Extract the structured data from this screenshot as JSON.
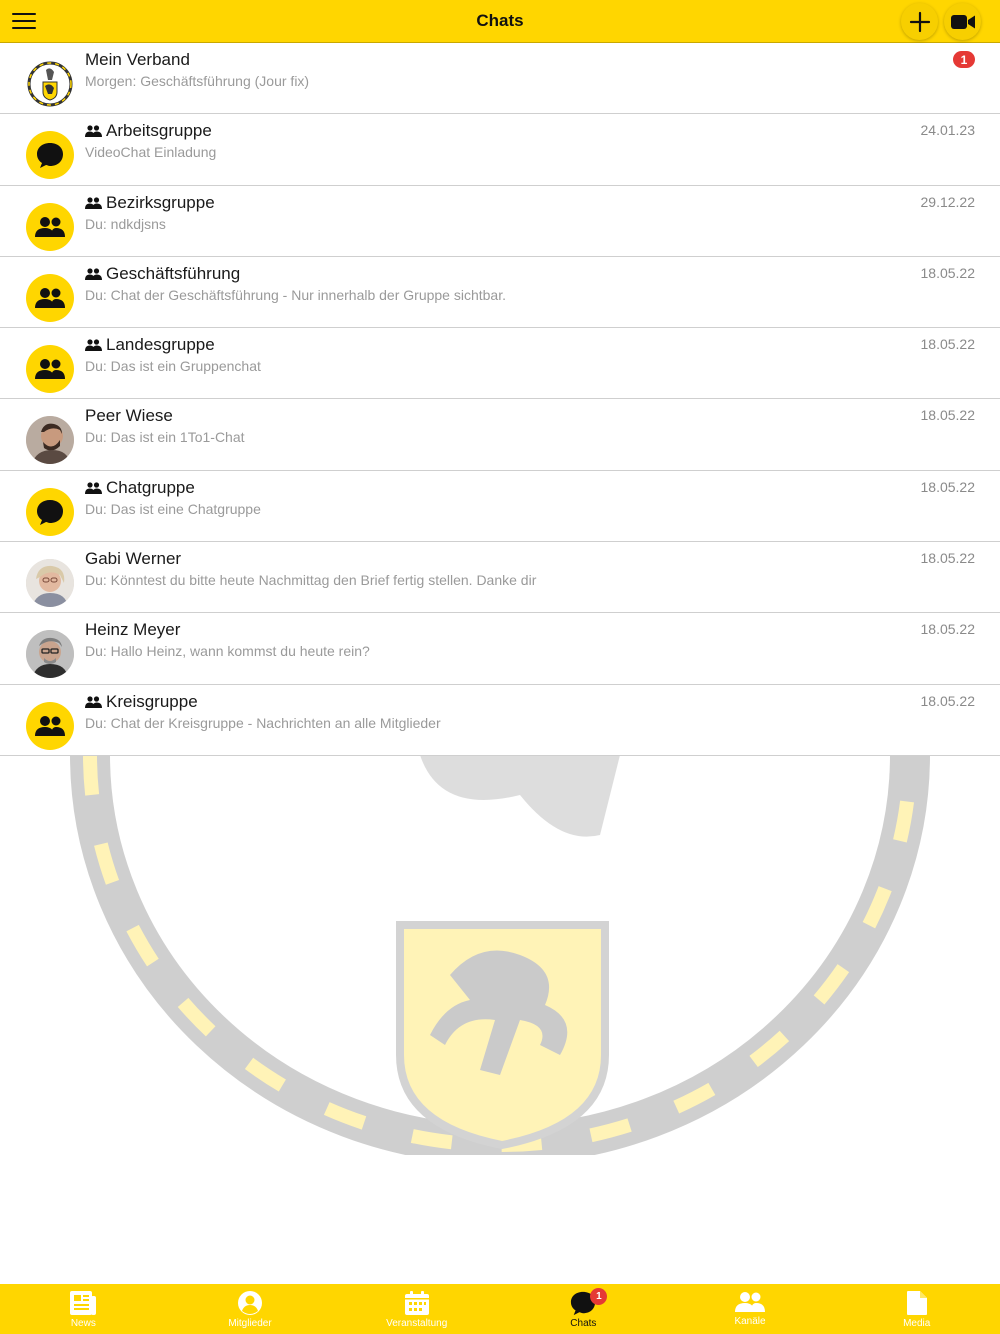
{
  "header": {
    "title": "Chats",
    "menu_icon": "hamburger-icon",
    "add_icon": "plus-icon",
    "video_icon": "video-camera-icon"
  },
  "colors": {
    "brand_yellow": "#ffd600",
    "badge_red": "#e53935",
    "muted_text": "#9a9a9a"
  },
  "chats": [
    {
      "name": "Mein Verband",
      "preview": "Morgen: Geschäftsführung (Jour fix)",
      "date": "",
      "unread": "1",
      "group": false,
      "avatar": "crest-logo"
    },
    {
      "name": "Arbeitsgruppe",
      "preview": "VideoChat Einladung",
      "date": "24.01.23",
      "group": true,
      "avatar": "chat-bubble-icon"
    },
    {
      "name": "Bezirksgruppe",
      "preview": "Du: ndkdjsns",
      "date": "29.12.22",
      "group": true,
      "avatar": "people-icon"
    },
    {
      "name": "Geschäftsführung",
      "preview": "Du: Chat der Geschäftsführung - Nur innerhalb der Gruppe sichtbar.",
      "date": "18.05.22",
      "group": true,
      "avatar": "people-icon"
    },
    {
      "name": "Landesgruppe",
      "preview": "Du: Das ist ein Gruppenchat",
      "date": "18.05.22",
      "group": true,
      "avatar": "people-icon"
    },
    {
      "name": "Peer Wiese",
      "preview": "Du: Das ist ein 1To1-Chat",
      "date": "18.05.22",
      "group": false,
      "avatar": "user-photo"
    },
    {
      "name": "Chatgruppe",
      "preview": "Du: Das ist eine Chatgruppe",
      "date": "18.05.22",
      "group": true,
      "avatar": "chat-bubble-icon"
    },
    {
      "name": "Gabi Werner",
      "preview": "Du: Könntest du bitte heute Nachmittag den Brief fertig stellen. Danke dir",
      "date": "18.05.22",
      "group": false,
      "avatar": "user-photo"
    },
    {
      "name": "Heinz Meyer",
      "preview": "Du: Hallo Heinz, wann kommst du heute rein?",
      "date": "18.05.22",
      "group": false,
      "avatar": "user-photo"
    },
    {
      "name": "Kreisgruppe",
      "preview": "Du: Chat der Kreisgruppe - Nachrichten an alle Mitglieder",
      "date": "18.05.22",
      "group": true,
      "avatar": "people-icon"
    }
  ],
  "tabs": [
    {
      "label": "News",
      "icon": "newspaper-icon",
      "active": false
    },
    {
      "label": "Mitglieder",
      "icon": "user-circle-icon",
      "active": false
    },
    {
      "label": "Veranstaltung",
      "icon": "calendar-icon",
      "active": false
    },
    {
      "label": "Chats",
      "icon": "chat-bubble-icon",
      "active": true,
      "badge": "1"
    },
    {
      "label": "Kanäle",
      "icon": "people-icon",
      "active": false
    },
    {
      "label": "Media",
      "icon": "document-icon",
      "active": false
    }
  ]
}
